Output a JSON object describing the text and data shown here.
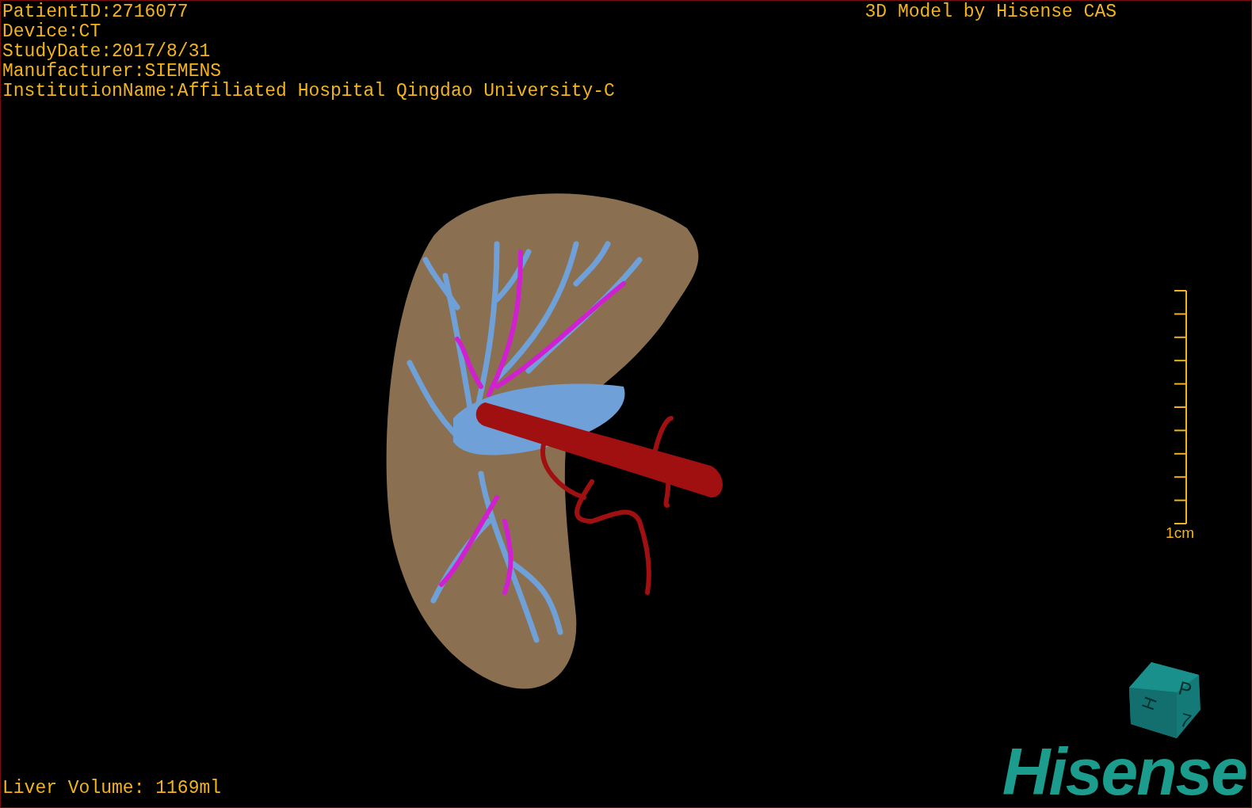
{
  "info_lines": [
    "PatientID:2716077",
    "Device:CT",
    "StudyDate:2017/8/31",
    "Manufacturer:SIEMENS",
    "InstitutionName:Affiliated Hospital Qingdao University-C"
  ],
  "title": "3D Model by Hisense CAS",
  "scale_bar": {
    "label": "1cm"
  },
  "orientation_cube": {
    "labels": [
      "H",
      "P",
      "7"
    ]
  },
  "liver_volume": "Liver Volume: 1169ml",
  "logo": "Hisense"
}
